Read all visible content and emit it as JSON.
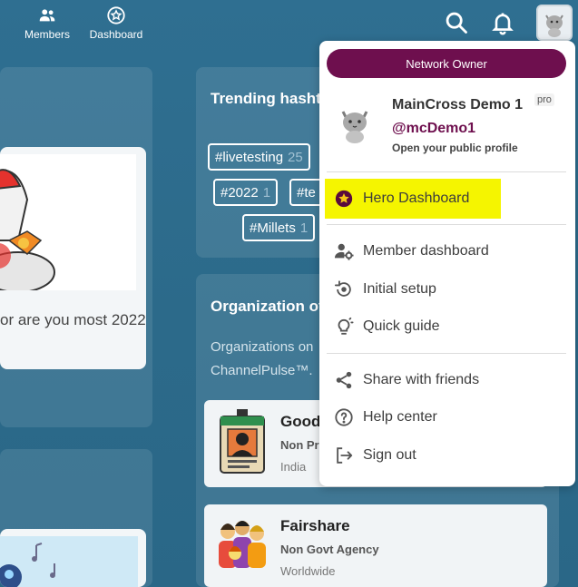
{
  "topnav": {
    "members_label": "Members",
    "dashboard_label": "Dashboard"
  },
  "trending": {
    "title": "Trending hashtags",
    "tags": [
      {
        "name": "#livetesting",
        "count": "25"
      },
      {
        "name": "#2022",
        "count": "1"
      },
      {
        "name": "#te",
        "count": ""
      },
      {
        "name": "#Millets",
        "count": "1"
      }
    ]
  },
  "hero_card": {
    "question": "or are you most 2022?"
  },
  "organizations": {
    "title": "Organization of",
    "description": "Organizations on ChannelPulse™.",
    "items": [
      {
        "name": "Good",
        "type": "Non Pr",
        "location": "India"
      },
      {
        "name": "Fairshare",
        "type": "Non Govt Agency",
        "location": "Worldwide"
      }
    ]
  },
  "menu": {
    "role_badge": "Network Owner",
    "profile_name": "MainCross Demo 1",
    "pro_badge": "pro",
    "profile_handle": "@mcDemo1",
    "profile_link": "Open your public profile",
    "items": {
      "hero": "Hero Dashboard",
      "member": "Member dashboard",
      "setup": "Initial setup",
      "guide": "Quick guide",
      "share": "Share with friends",
      "help": "Help center",
      "signout": "Sign out"
    }
  },
  "colors": {
    "background": "#2f6f91",
    "brand": "#6e0f4e",
    "highlight": "#f5f500"
  }
}
